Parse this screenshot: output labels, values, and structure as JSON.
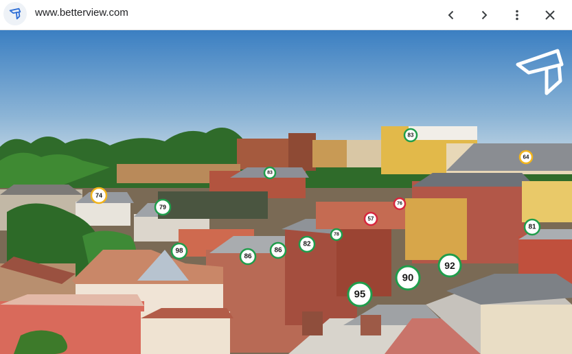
{
  "browser": {
    "url": "www.betterview.com",
    "icons": {
      "favicon": "betterview-logo-icon",
      "back": "chevron-left-icon",
      "forward": "chevron-right-icon",
      "menu": "more-vert-icon",
      "close": "close-icon"
    }
  },
  "hero": {
    "logo": "betterview-logo-icon",
    "colors": {
      "sky_top": "#3b7fc2",
      "sky_bottom": "#dfe8ee",
      "marker_green": "#1f9d4b",
      "marker_yellow": "#f3b51b",
      "marker_red": "#d7263d"
    },
    "markers": [
      {
        "label": "83",
        "color": "green"
      },
      {
        "label": "64",
        "color": "yellow"
      },
      {
        "label": "83",
        "color": "green"
      },
      {
        "label": "74",
        "color": "yellow"
      },
      {
        "label": "79",
        "color": "green"
      },
      {
        "label": "76",
        "color": "red"
      },
      {
        "label": "57",
        "color": "red"
      },
      {
        "label": "78",
        "color": "green"
      },
      {
        "label": "82",
        "color": "green"
      },
      {
        "label": "86",
        "color": "green"
      },
      {
        "label": "86",
        "color": "green"
      },
      {
        "label": "98",
        "color": "green"
      },
      {
        "label": "81",
        "color": "green"
      },
      {
        "label": "92",
        "color": "green"
      },
      {
        "label": "90",
        "color": "green"
      },
      {
        "label": "95",
        "color": "green"
      }
    ]
  }
}
